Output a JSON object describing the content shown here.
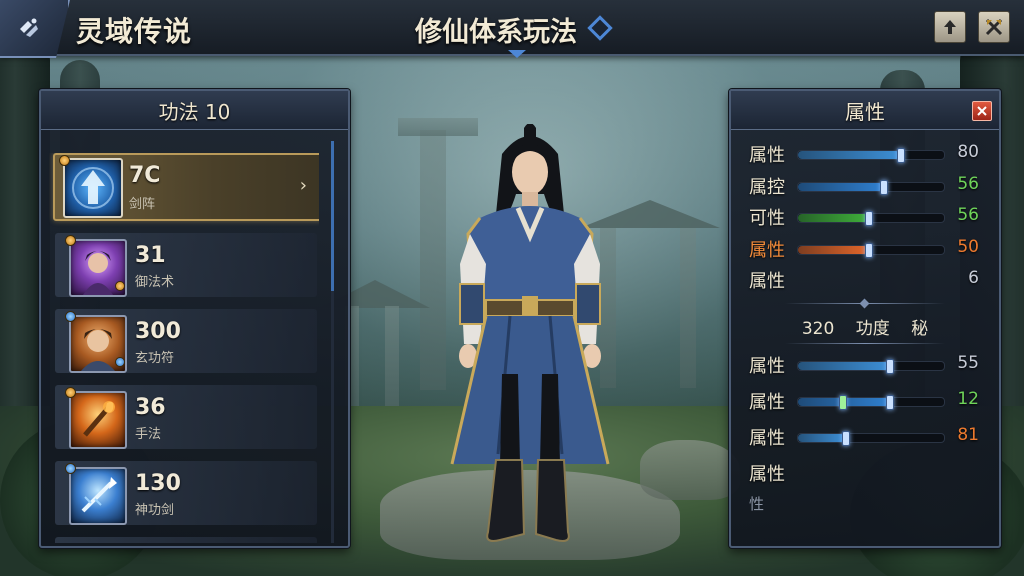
{
  "header": {
    "game_title": "灵域传说",
    "page_title": "修仙体系玩法",
    "menu_icon": "menu-icon",
    "upload_icon": "arrow-up-icon",
    "swords_icon": "crossed-swords-icon"
  },
  "skills_panel": {
    "title": "功法 10",
    "items": [
      {
        "value": "7C",
        "sub": "剑阵",
        "icon": "arrow-rune-icon",
        "selected": true
      },
      {
        "value": "31",
        "sub": "御法术",
        "icon": "sorcerer-portrait-icon"
      },
      {
        "value": "300",
        "sub": "玄功符",
        "icon": "hero-portrait-icon"
      },
      {
        "value": "36",
        "sub": "手法",
        "icon": "flame-staff-icon"
      },
      {
        "value": "130",
        "sub": "神功剑",
        "icon": "ice-spear-icon"
      }
    ]
  },
  "stats_panel": {
    "title": "属性",
    "stats": [
      {
        "label": "属性",
        "value": "80",
        "fill": 0.7,
        "color": "#3d8fd6",
        "label_style": "",
        "val_style": "gray"
      },
      {
        "label": "属控",
        "value": "56",
        "fill": 0.58,
        "color": "#2f7fcf",
        "label_style": "",
        "val_style": "green"
      },
      {
        "label": "可性",
        "value": "56",
        "fill": 0.48,
        "color": "#3fae3a",
        "label_style": "",
        "val_style": "green"
      },
      {
        "label": "属性",
        "value": "50",
        "fill": 0.48,
        "color": "#e2662a",
        "label_style": "orange",
        "val_style": "orange"
      },
      {
        "label": "属性",
        "value": "6",
        "fill": null,
        "color": "",
        "label_style": "",
        "val_style": "gray"
      }
    ],
    "section": {
      "a": "320",
      "b": "功度",
      "c": "秘"
    },
    "stats2": [
      {
        "label": "属性",
        "value": "55",
        "fill": 0.62,
        "color": "#3d8fd6",
        "val_style": "gray"
      },
      {
        "label": "属性",
        "value": "12",
        "fill": 0.62,
        "color": "#2f7fcf",
        "val_style": "green",
        "mid_knob": 0.3
      },
      {
        "label": "属性",
        "value": "81",
        "fill": 0.32,
        "color": "#3d8fd6",
        "val_style": "orange"
      },
      {
        "label": "属性",
        "value": "",
        "fill": null,
        "color": "",
        "val_style": "gray"
      }
    ],
    "footer": "性"
  },
  "colors": {
    "accent": "#4d87d6",
    "gold": "#b99a5a",
    "green": "#6fd45a",
    "orange": "#ee7a2e"
  }
}
